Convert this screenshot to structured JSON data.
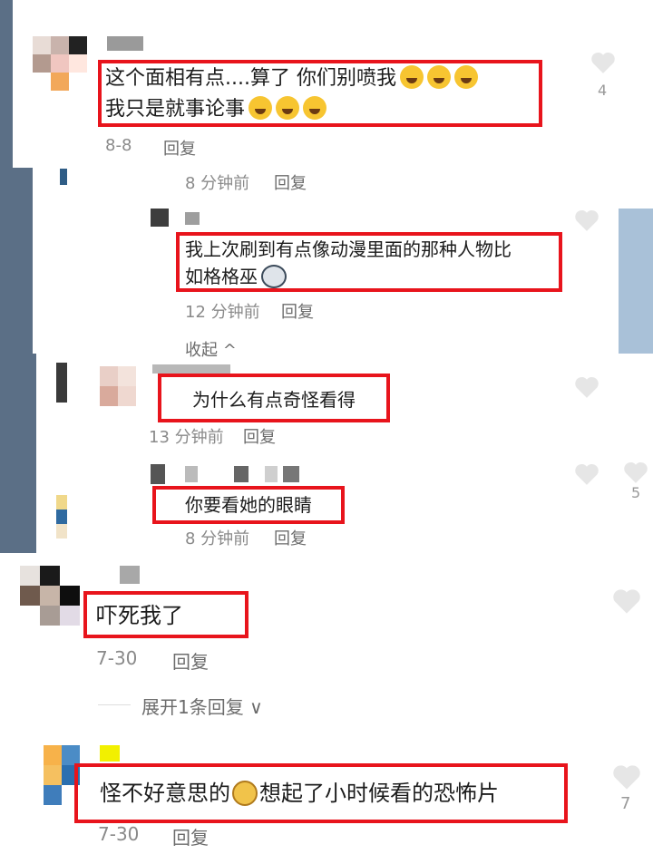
{
  "comments": [
    {
      "text": "这个面相有点....算了 你们别喷我",
      "emoji_icons": [
        "rofl-emoji",
        "rofl-emoji",
        "rofl-emoji"
      ],
      "text2": "我只是就事论事",
      "emoji_icons2": [
        "laugh-cry-emoji",
        "laugh-cry-emoji",
        "laugh-cry-emoji"
      ],
      "date": "8-8",
      "reply": "回复",
      "likes": "4"
    },
    {
      "time": "8 分钟前",
      "reply": "回复"
    },
    {
      "text": "我上次刷到有点像动漫里面的那种人物比",
      "text2": "如格格巫",
      "emoji_icon": "cat-emoji",
      "time": "12 分钟前",
      "reply": "回复"
    },
    {
      "collapse": "收起"
    },
    {
      "text": "为什么有点奇怪看得",
      "time": "13 分钟前",
      "reply": "回复"
    },
    {
      "text": "你要看她的眼睛",
      "time": "8 分钟前",
      "reply": "回复",
      "likes": "5"
    },
    {
      "text": "吓死我了",
      "date": "7-30",
      "reply": "回复",
      "expand": "展开1条回复"
    },
    {
      "text": "怪不好意思的",
      "emoji_icon": "shy-emoji",
      "text2": "想起了小时候看的恐怖片",
      "date": "7-30",
      "reply": "回复",
      "likes": "7"
    }
  ],
  "colors": {
    "highlight": "#e8141c",
    "meta": "#8a8a8a",
    "heart": "#e6e6e6"
  }
}
